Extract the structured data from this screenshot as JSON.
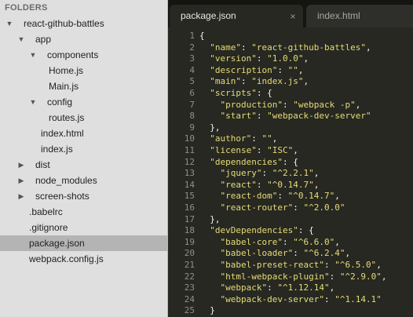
{
  "sidebar": {
    "header": "FOLDERS",
    "tree": [
      {
        "label": "react-github-battles",
        "depth": 0,
        "arrow": "down",
        "selected": false
      },
      {
        "label": "app",
        "depth": 1,
        "arrow": "down",
        "selected": false
      },
      {
        "label": "components",
        "depth": 2,
        "arrow": "down",
        "selected": false
      },
      {
        "label": "Home.js",
        "depth": 3,
        "arrow": "",
        "selected": false
      },
      {
        "label": "Main.js",
        "depth": 3,
        "arrow": "",
        "selected": false
      },
      {
        "label": "config",
        "depth": 2,
        "arrow": "down",
        "selected": false
      },
      {
        "label": "routes.js",
        "depth": 3,
        "arrow": "",
        "selected": false
      },
      {
        "label": "index.html",
        "depth": 2,
        "arrow": "",
        "selected": false
      },
      {
        "label": "index.js",
        "depth": 2,
        "arrow": "",
        "selected": false
      },
      {
        "label": "dist",
        "depth": 1,
        "arrow": "right",
        "selected": false
      },
      {
        "label": "node_modules",
        "depth": 1,
        "arrow": "right",
        "selected": false
      },
      {
        "label": "screen-shots",
        "depth": 1,
        "arrow": "right",
        "selected": false
      },
      {
        "label": ".babelrc",
        "depth": 1,
        "arrow": "",
        "selected": false
      },
      {
        "label": ".gitignore",
        "depth": 1,
        "arrow": "",
        "selected": false
      },
      {
        "label": "package.json",
        "depth": 1,
        "arrow": "",
        "selected": true
      },
      {
        "label": "webpack.config.js",
        "depth": 1,
        "arrow": "",
        "selected": false
      }
    ]
  },
  "tabs": [
    {
      "label": "package.json",
      "active": true,
      "close": "×"
    },
    {
      "label": "index.html",
      "active": false,
      "close": ""
    }
  ],
  "icons": {
    "expanded": "chevron-down-icon",
    "collapsed": "chevron-right-icon",
    "close": "close-icon"
  },
  "colors": {
    "string": "#e6db74",
    "text": "#f8f8f2",
    "line_number": "#8f908a",
    "editor_bg": "#272822",
    "sidebar_bg": "#dfdfdf",
    "selected_row": "#b4b4b4"
  },
  "code_lines": [
    "{",
    "  \"name\": \"react-github-battles\",",
    "  \"version\": \"1.0.0\",",
    "  \"description\": \"\",",
    "  \"main\": \"index.js\",",
    "  \"scripts\": {",
    "    \"production\": \"webpack -p\",",
    "    \"start\": \"webpack-dev-server\"",
    "  },",
    "  \"author\": \"\",",
    "  \"license\": \"ISC\",",
    "  \"dependencies\": {",
    "    \"jquery\": \"^2.2.1\",",
    "    \"react\": \"^0.14.7\",",
    "    \"react-dom\": \"^0.14.7\",",
    "    \"react-router\": \"^2.0.0\"",
    "  },",
    "  \"devDependencies\": {",
    "    \"babel-core\": \"^6.6.0\",",
    "    \"babel-loader\": \"^6.2.4\",",
    "    \"babel-preset-react\": \"^6.5.0\",",
    "    \"html-webpack-plugin\": \"^2.9.0\",",
    "    \"webpack\": \"^1.12.14\",",
    "    \"webpack-dev-server\": \"^1.14.1\"",
    "  }",
    "}"
  ]
}
